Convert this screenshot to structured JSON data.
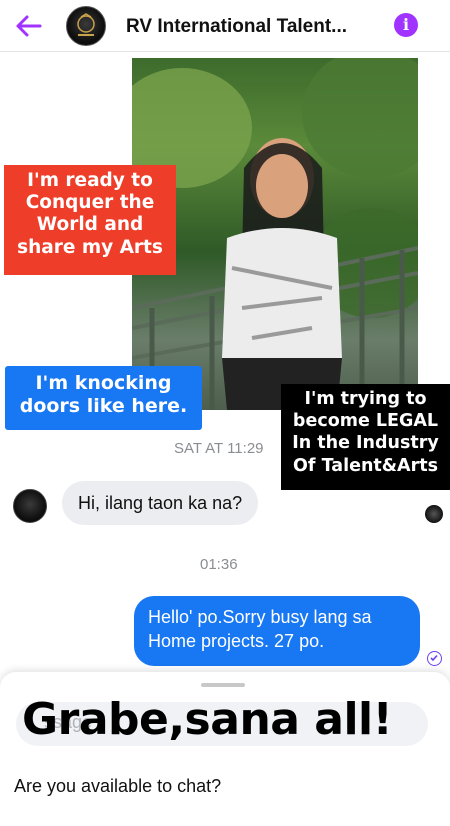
{
  "header": {
    "title": "RV International Talent...",
    "back_icon": "arrow-left-icon",
    "info_icon": "info-icon",
    "accent_color": "#a033ff"
  },
  "captions": {
    "red": "I'm ready to Conquer the World and share my Arts",
    "blue": "I'm knocking doors like here.",
    "black": "I'm trying to become LEGAL In the Industry Of Talent&Arts"
  },
  "messages": [
    {
      "timestamp": "SAT AT 11:29"
    },
    {
      "text": "Hi, ilang taon ka na?",
      "from": "them"
    },
    {
      "timestamp": "01:36"
    },
    {
      "text": "Hello' po.Sorry busy lang sa Home projects. 27 po.",
      "from": "me"
    }
  ],
  "composer": {
    "overlay_text": "Grabe,sana all!",
    "placeholder_fragment": "ssage",
    "prompt": "Are you available to chat?"
  },
  "colors": {
    "red_caption": "#ee3e2a",
    "blue_caption": "#1877f2",
    "black_caption": "#000000",
    "outgoing_bubble": "#1877f2",
    "incoming_bubble": "#ebedf0"
  }
}
